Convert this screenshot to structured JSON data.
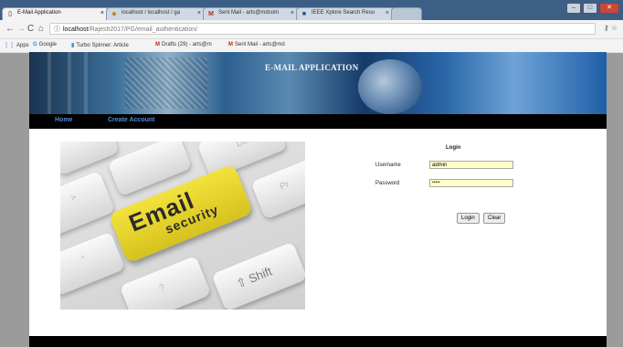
{
  "browser": {
    "tabs": [
      {
        "label": "E-Mail Application",
        "active": true
      },
      {
        "label": "localhost / localhost / ga",
        "active": false
      },
      {
        "label": "Sent Mail - arts@mdcom",
        "active": false
      },
      {
        "label": "IEEE Xplore Search Resu",
        "active": false
      }
    ],
    "url_host": "localhost",
    "url_path": "/Rajesh2017/PG/email_authentication/",
    "bookmarks": [
      {
        "label": "Apps",
        "icon": "apps-grid-icon"
      },
      {
        "label": "Google",
        "icon": "google-icon"
      },
      {
        "label": "Turbo Spinner: Article",
        "icon": "turbo-spinner-icon"
      },
      {
        "label": "Drafts (29) - arts@m",
        "icon": "gmail-icon"
      },
      {
        "label": "Sent Mail - arts@md",
        "icon": "gmail-icon"
      }
    ]
  },
  "page": {
    "banner_title": "E-MAIL APPLICATION",
    "nav": [
      "Home",
      "Create Account"
    ],
    "hero": {
      "key_word_1": "Email",
      "key_word_2": "security",
      "shift_label": "Shift",
      "other_keys": [
        "Del",
        "Pr",
        "?",
        "“",
        ">"
      ]
    },
    "login": {
      "title": "Login",
      "username_label": "Username",
      "username_value": "admin",
      "password_label": "Password",
      "password_value": "•••••",
      "login_button": "Login",
      "clear_button": "Clear"
    }
  },
  "colors": {
    "nav_link": "#4f8bd6",
    "input_bg": "#ffffc8",
    "navbar_bg": "#000000",
    "key_yellow": "#e8d52c"
  }
}
